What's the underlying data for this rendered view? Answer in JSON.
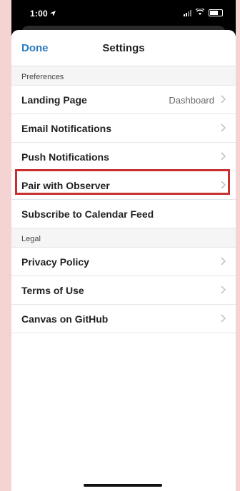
{
  "status_bar": {
    "time": "1:00",
    "location_icon": "location-arrow-icon",
    "signal_icon": "cellular-signal-icon",
    "wifi_icon": "wifi-icon",
    "battery_icon": "battery-icon"
  },
  "nav": {
    "done_label": "Done",
    "title": "Settings"
  },
  "sections": {
    "preferences": {
      "header": "Preferences",
      "items": [
        {
          "label": "Landing Page",
          "value": "Dashboard"
        },
        {
          "label": "Email Notifications"
        },
        {
          "label": "Push Notifications"
        },
        {
          "label": "Pair with Observer"
        },
        {
          "label": "Subscribe to Calendar Feed"
        }
      ]
    },
    "legal": {
      "header": "Legal",
      "items": [
        {
          "label": "Privacy Policy"
        },
        {
          "label": "Terms of Use"
        },
        {
          "label": "Canvas on GitHub"
        }
      ]
    }
  },
  "colors": {
    "accent": "#2b7bc0",
    "highlight": "#c6312f",
    "background": "#f6d3d3"
  }
}
